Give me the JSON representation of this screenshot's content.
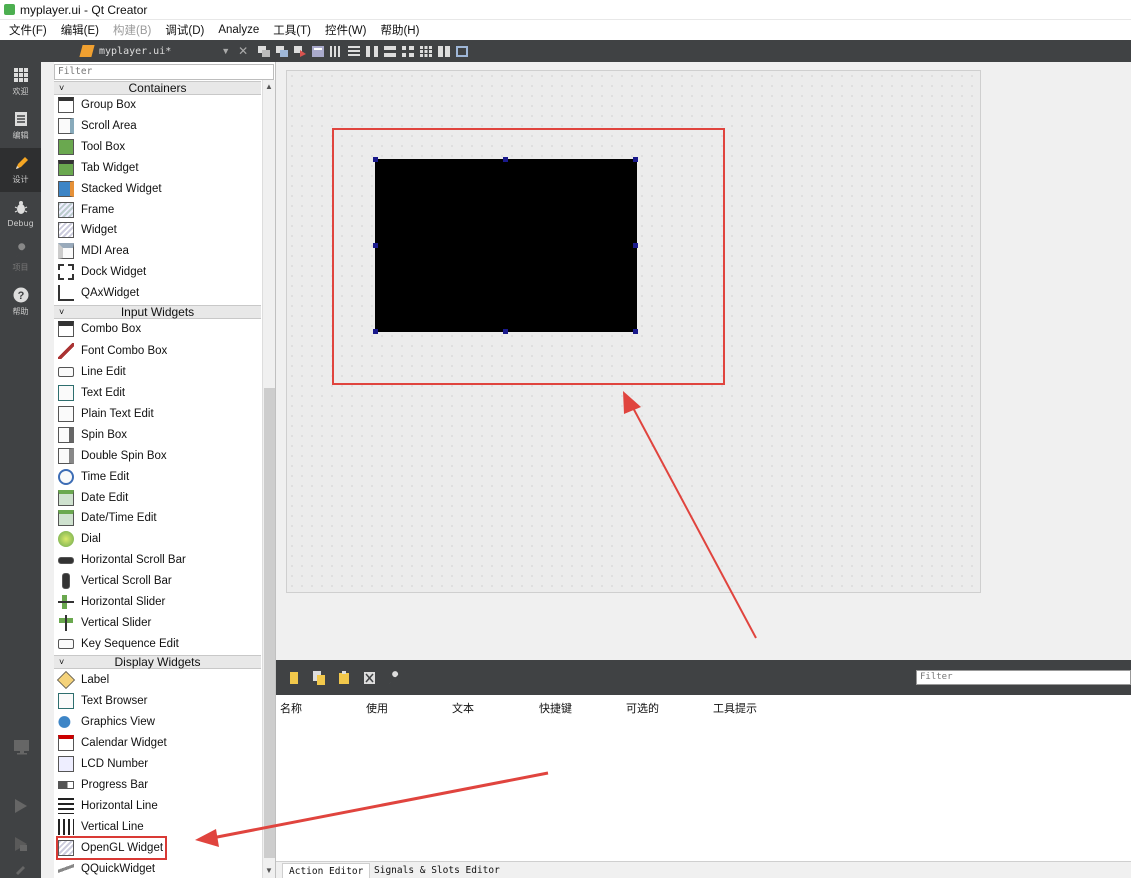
{
  "window": {
    "title": "myplayer.ui - Qt Creator"
  },
  "menu": [
    {
      "label": "文件(F)",
      "enabled": true
    },
    {
      "label": "编辑(E)",
      "enabled": true
    },
    {
      "label": "构建(B)",
      "enabled": false
    },
    {
      "label": "调试(D)",
      "enabled": true
    },
    {
      "label": "Analyze",
      "enabled": true
    },
    {
      "label": "工具(T)",
      "enabled": true
    },
    {
      "label": "控件(W)",
      "enabled": true
    },
    {
      "label": "帮助(H)",
      "enabled": true
    }
  ],
  "modes": [
    {
      "label": "欢迎",
      "icon": "grid-icon"
    },
    {
      "label": "编辑",
      "icon": "document-icon"
    },
    {
      "label": "设计",
      "icon": "pencil-icon",
      "active": true
    },
    {
      "label": "Debug",
      "icon": "bug-icon"
    },
    {
      "label": "项目",
      "icon": "wrench-icon"
    },
    {
      "label": "帮助",
      "icon": "question-icon"
    }
  ],
  "document": {
    "filename": "myplayer.ui*"
  },
  "widgetbox": {
    "filter_placeholder": "Filter",
    "categories": {
      "containers": "Containers",
      "input": "Input Widgets",
      "display": "Display Widgets"
    },
    "containers": [
      "Group Box",
      "Scroll Area",
      "Tool Box",
      "Tab Widget",
      "Stacked Widget",
      "Frame",
      "Widget",
      "MDI Area",
      "Dock Widget",
      "QAxWidget"
    ],
    "input": [
      "Combo Box",
      "Font Combo Box",
      "Line Edit",
      "Text Edit",
      "Plain Text Edit",
      "Spin Box",
      "Double Spin Box",
      "Time Edit",
      "Date Edit",
      "Date/Time Edit",
      "Dial",
      "Horizontal Scroll Bar",
      "Vertical Scroll Bar",
      "Horizontal Slider",
      "Vertical Slider",
      "Key Sequence Edit"
    ],
    "display": [
      "Label",
      "Text Browser",
      "Graphics View",
      "Calendar Widget",
      "LCD Number",
      "Progress Bar",
      "Horizontal Line",
      "Vertical Line",
      "OpenGL Widget",
      "QQuickWidget"
    ],
    "highlighted": "OpenGL Widget"
  },
  "action_editor": {
    "filter_placeholder": "Filter",
    "columns": [
      "名称",
      "使用",
      "文本",
      "快捷键",
      "可选的",
      "工具提示"
    ]
  },
  "bottom_tabs": [
    "Action Editor",
    "Signals & Slots Editor"
  ],
  "colors": {
    "annotation_red": "#e0443e",
    "sidebar": "#404244",
    "handle": "#1a1a8c"
  }
}
